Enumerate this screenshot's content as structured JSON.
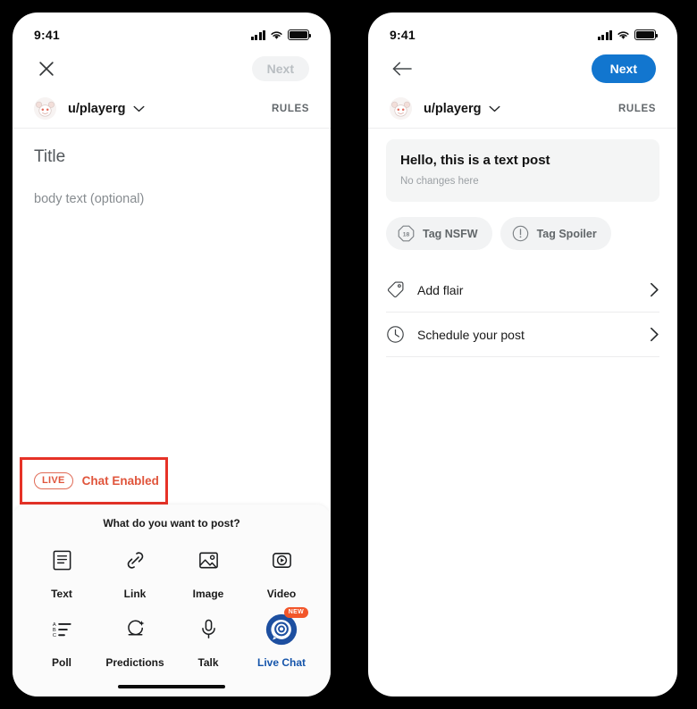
{
  "status_bar": {
    "time": "9:41",
    "signal_icon": "cellular-signal-icon",
    "wifi_icon": "wifi-icon",
    "battery_icon": "battery-icon"
  },
  "left_screen": {
    "nav": {
      "close_icon": "close-icon",
      "next_label": "Next",
      "next_state": "disabled"
    },
    "account": {
      "avatar_icon": "user-avatar-icon",
      "username": "u/playerg",
      "caret_icon": "chevron-down-icon",
      "rules_label": "RULES"
    },
    "compose": {
      "title_placeholder": "Title",
      "body_placeholder": "body text (optional)"
    },
    "live_banner": {
      "pill_label": "LIVE",
      "text": "Chat Enabled",
      "highlight_color": "#e63227",
      "accent_color": "#e0553c"
    },
    "sheet": {
      "title": "What do you want to post?",
      "options": [
        {
          "label": "Text",
          "icon": "text-post-icon",
          "accent": false,
          "badge": ""
        },
        {
          "label": "Link",
          "icon": "link-icon",
          "accent": false,
          "badge": ""
        },
        {
          "label": "Image",
          "icon": "image-icon",
          "accent": false,
          "badge": ""
        },
        {
          "label": "Video",
          "icon": "video-play-icon",
          "accent": false,
          "badge": ""
        },
        {
          "label": "Poll",
          "icon": "poll-list-icon",
          "accent": false,
          "badge": ""
        },
        {
          "label": "Predictions",
          "icon": "predictions-icon",
          "accent": false,
          "badge": ""
        },
        {
          "label": "Talk",
          "icon": "microphone-icon",
          "accent": false,
          "badge": ""
        },
        {
          "label": "Live Chat",
          "icon": "live-chat-target-icon",
          "accent": true,
          "badge": "NEW"
        }
      ],
      "home_indicator": "home-indicator"
    }
  },
  "right_screen": {
    "nav": {
      "back_icon": "back-arrow-icon",
      "next_label": "Next",
      "next_state": "enabled",
      "next_color": "#1276cf"
    },
    "account": {
      "avatar_icon": "user-avatar-icon",
      "username": "u/playerg",
      "caret_icon": "chevron-down-icon",
      "rules_label": "RULES"
    },
    "post_card": {
      "title": "Hello, this is a text post",
      "subtitle": "No changes here"
    },
    "tag_chips": [
      {
        "label": "Tag NSFW",
        "icon": "nsfw-18-icon"
      },
      {
        "label": "Tag Spoiler",
        "icon": "spoiler-alert-icon"
      }
    ],
    "setting_rows": [
      {
        "label": "Add flair",
        "icon": "flair-tag-icon",
        "chevron": "chevron-right-icon"
      },
      {
        "label": "Schedule your post",
        "icon": "clock-icon",
        "chevron": "chevron-right-icon"
      }
    ]
  }
}
